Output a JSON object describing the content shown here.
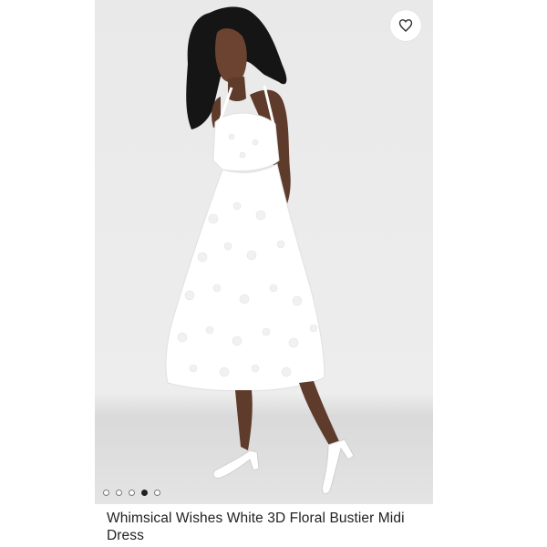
{
  "product": {
    "title": "Whimsical Wishes White 3D Floral Bustier Midi Dress"
  },
  "wishlist": {
    "icon": "heart-icon"
  },
  "gallery": {
    "image_count": 5,
    "active_index": 3
  },
  "colors": {
    "background": "#ececec",
    "dress": "#ffffff",
    "dot_active": "#222222"
  }
}
